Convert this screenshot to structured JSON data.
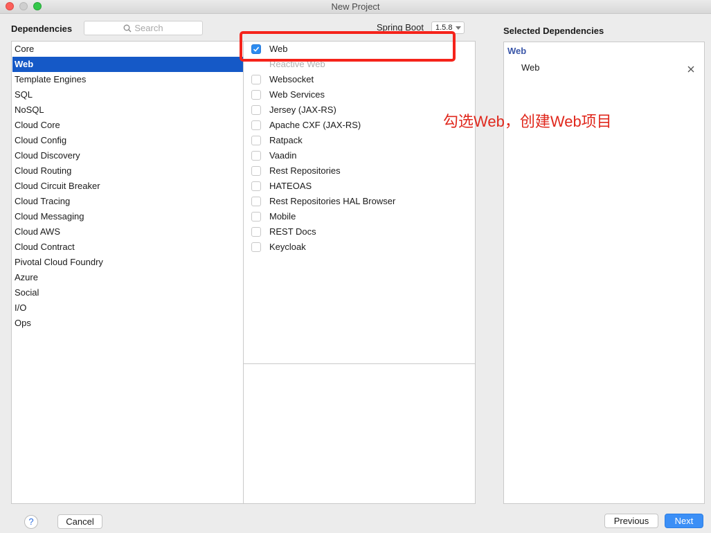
{
  "window": {
    "title": "New Project"
  },
  "header": {
    "dependencies_label": "Dependencies",
    "search_placeholder": "Search",
    "spring_boot_label": "Spring Boot",
    "spring_boot_version": "1.5.8"
  },
  "categories": [
    {
      "label": "Core",
      "selected": false
    },
    {
      "label": "Web",
      "selected": true
    },
    {
      "label": "Template Engines",
      "selected": false
    },
    {
      "label": "SQL",
      "selected": false
    },
    {
      "label": "NoSQL",
      "selected": false
    },
    {
      "label": "Cloud Core",
      "selected": false
    },
    {
      "label": "Cloud Config",
      "selected": false
    },
    {
      "label": "Cloud Discovery",
      "selected": false
    },
    {
      "label": "Cloud Routing",
      "selected": false
    },
    {
      "label": "Cloud Circuit Breaker",
      "selected": false
    },
    {
      "label": "Cloud Tracing",
      "selected": false
    },
    {
      "label": "Cloud Messaging",
      "selected": false
    },
    {
      "label": "Cloud AWS",
      "selected": false
    },
    {
      "label": "Cloud Contract",
      "selected": false
    },
    {
      "label": "Pivotal Cloud Foundry",
      "selected": false
    },
    {
      "label": "Azure",
      "selected": false
    },
    {
      "label": "Social",
      "selected": false
    },
    {
      "label": "I/O",
      "selected": false
    },
    {
      "label": "Ops",
      "selected": false
    }
  ],
  "dependencies": [
    {
      "label": "Web",
      "checked": true,
      "enabled": true
    },
    {
      "label": "Reactive Web",
      "checked": false,
      "enabled": false
    },
    {
      "label": "Websocket",
      "checked": false,
      "enabled": true
    },
    {
      "label": "Web Services",
      "checked": false,
      "enabled": true
    },
    {
      "label": "Jersey (JAX-RS)",
      "checked": false,
      "enabled": true
    },
    {
      "label": "Apache CXF (JAX-RS)",
      "checked": false,
      "enabled": true
    },
    {
      "label": "Ratpack",
      "checked": false,
      "enabled": true
    },
    {
      "label": "Vaadin",
      "checked": false,
      "enabled": true
    },
    {
      "label": "Rest Repositories",
      "checked": false,
      "enabled": true
    },
    {
      "label": "HATEOAS",
      "checked": false,
      "enabled": true
    },
    {
      "label": "Rest Repositories HAL Browser",
      "checked": false,
      "enabled": true
    },
    {
      "label": "Mobile",
      "checked": false,
      "enabled": true
    },
    {
      "label": "REST Docs",
      "checked": false,
      "enabled": true
    },
    {
      "label": "Keycloak",
      "checked": false,
      "enabled": true
    }
  ],
  "selected_panel": {
    "title": "Selected Dependencies",
    "group": "Web",
    "items": [
      "Web"
    ]
  },
  "annotation": {
    "text": "勾选Web，创建Web项目",
    "color": "#e0281d"
  },
  "footer": {
    "help_label": "?",
    "cancel_label": "Cancel",
    "previous_label": "Previous",
    "next_label": "Next"
  },
  "colors": {
    "selection": "#1559c7",
    "accent": "#3b8ff6",
    "annotation_box": "#f5231b"
  }
}
